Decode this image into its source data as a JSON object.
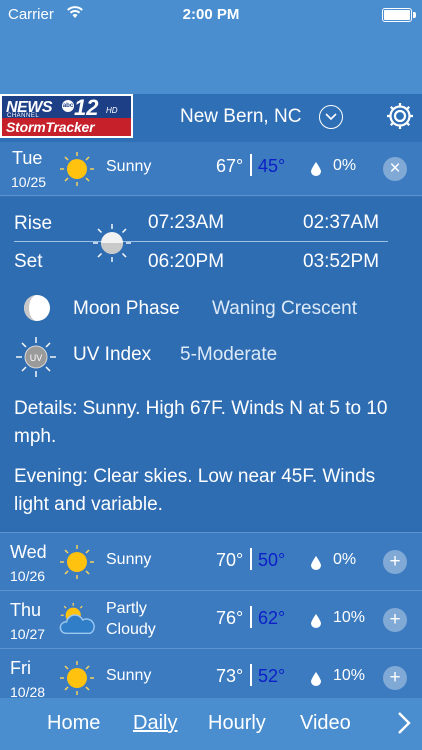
{
  "status_bar": {
    "carrier": "Carrier",
    "time": "2:00 PM"
  },
  "header": {
    "logo": {
      "news": "NEWS",
      "channel": "CHANNEL",
      "number": "12",
      "hd": "HD",
      "network": "abc",
      "brand": "StormTracker"
    },
    "location": "New Bern, NC"
  },
  "today": {
    "day": "Tue",
    "date": "10/25",
    "condition": "Sunny",
    "high": "67°",
    "low": "45°",
    "precip": "0%",
    "toggle": "×",
    "icon": "sun-icon"
  },
  "detail": {
    "rise_label": "Rise",
    "set_label": "Set",
    "sunrise": "07:23AM",
    "sunset": "06:20PM",
    "moonrise": "02:37AM",
    "moonset": "03:52PM",
    "moon_phase_label": "Moon Phase",
    "moon_phase": "Waning Crescent",
    "uv_label": "UV Index",
    "uv_value": "5-Moderate",
    "uv_badge": "UV",
    "details": "Details: Sunny. High 67F. Winds N at 5 to 10 mph.",
    "evening": "Evening: Clear skies. Low near 45F. Winds light and variable."
  },
  "forecast": [
    {
      "day": "Wed",
      "date": "10/26",
      "condition": "Sunny",
      "high": "70°",
      "low": "50°",
      "precip": "0%",
      "toggle": "+",
      "icon": "sun-icon"
    },
    {
      "day": "Thu",
      "date": "10/27",
      "condition": "Partly Cloudy",
      "condition_line1": "Partly",
      "condition_line2": "Cloudy",
      "high": "76°",
      "low": "62°",
      "precip": "10%",
      "toggle": "+",
      "icon": "partly-cloudy-icon"
    },
    {
      "day": "Fri",
      "date": "10/28",
      "condition": "Sunny",
      "high": "73°",
      "low": "52°",
      "precip": "10%",
      "toggle": "+",
      "icon": "sun-icon"
    }
  ],
  "tabs": [
    {
      "label": "Home",
      "active": false
    },
    {
      "label": "Daily",
      "active": true
    },
    {
      "label": "Hourly",
      "active": false
    },
    {
      "label": "Video",
      "active": false
    }
  ],
  "colors": {
    "low_temp": "#0c1fc8",
    "sun": "#ffc20e",
    "logo_red": "#c6202a",
    "logo_navy": "#1d3f86"
  }
}
